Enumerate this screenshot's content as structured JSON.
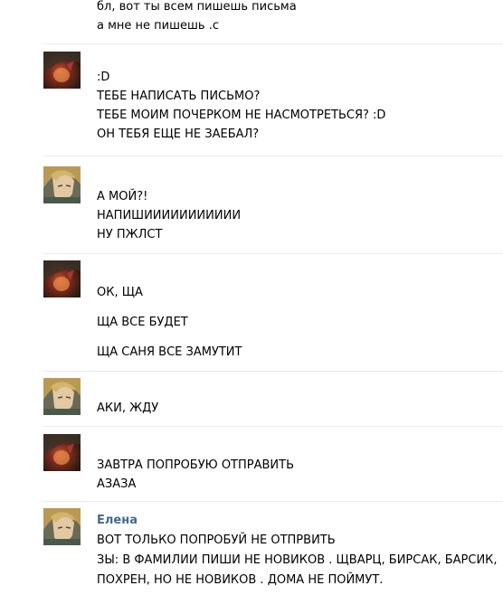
{
  "messages": [
    {
      "author": "",
      "avatar": "none",
      "lines": [
        "бл, вот ты всем пишешь письма",
        "а мне не пишешь .с"
      ]
    },
    {
      "author": "",
      "avatar": "dark-red-avatar",
      "lines": [
        ":D",
        "ТЕБЕ НАПИСАТЬ ПИСЬМО?",
        "ТЕБЕ МОИМ ПОЧЕРКОМ НЕ НАСМОТРЕТЬСЯ? :D",
        "ОН ТЕБЯ ЕЩЕ НЕ ЗАЕБАЛ?"
      ]
    },
    {
      "author": "",
      "avatar": "blonde-avatar",
      "lines": [
        "А МОЙ?!",
        "НАПИШИИИИИИИИИИИ",
        "НУ ПЖЛСТ"
      ]
    },
    {
      "author": "",
      "avatar": "dark-red-avatar",
      "lines": [
        "ОК, ЩА",
        "ЩА ВСЕ БУДЕТ",
        "ЩА САНЯ ВСЕ ЗАМУТИТ"
      ]
    },
    {
      "author": "",
      "avatar": "blonde-avatar",
      "lines": [
        "АКИ, ЖДУ"
      ]
    },
    {
      "author": "",
      "avatar": "dark-red-avatar",
      "lines": [
        "ЗАВТРА ПОПРОБУЮ ОТПРАВИТЬ",
        "АЗАЗА"
      ]
    },
    {
      "author": "Елена",
      "avatar": "blonde-avatar",
      "lines": [
        "ВОТ ТОЛЬКО ПОПРОБУЙ НЕ ОТПРВИТЬ",
        "ЗЫ: В ФАМИЛИИ ПИШИ НЕ НОВИКОВ  . ЩВАРЦ, БИРСАК, БАРСИК,",
        "ПОХРЕН, НО НЕ НОВИКОВ  . ДОМА НЕ ПОЙМУТ."
      ]
    }
  ],
  "colors": {
    "author_link": "#45688e",
    "divider": "#e7eaed",
    "text": "#000000"
  }
}
